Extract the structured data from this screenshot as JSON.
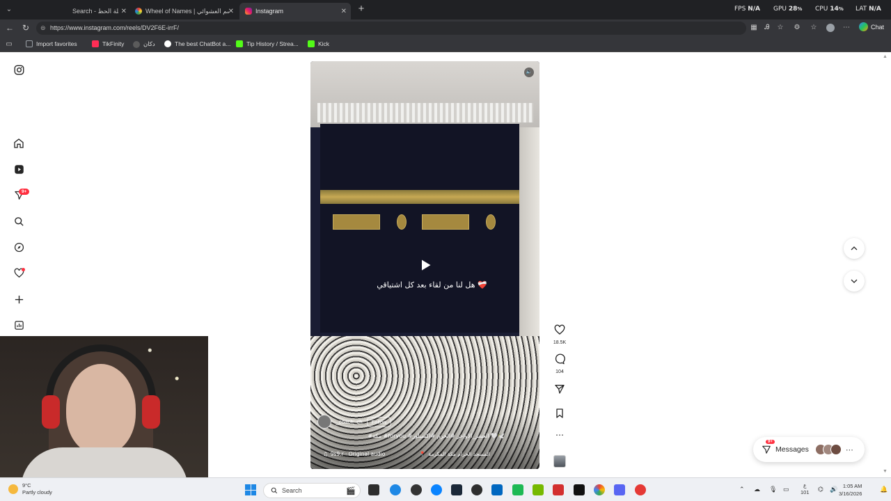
{
  "browser": {
    "tabs": [
      {
        "label": "Search - عجلة الحظ",
        "active": false
      },
      {
        "label": "Wheel of Names | الاسم العشوائي",
        "active": false
      },
      {
        "label": "Instagram",
        "active": true
      }
    ],
    "perf": {
      "fps_label": "FPS",
      "fps_value": "N/A",
      "gpu_label": "GPU",
      "gpu_value": "28",
      "gpu_unit": "%",
      "cpu_label": "CPU",
      "cpu_value": "14",
      "cpu_unit": "%",
      "lat_label": "LAT",
      "lat_value": "N/A"
    },
    "url": "https://www.instagram.com/reels/DV2F6E-irrF/",
    "chat_label": "Chat",
    "bookmarks": [
      {
        "label": "Import favorites",
        "color": "#9aa0a6"
      },
      {
        "label": "TikFinity",
        "color": "#ff2d55"
      },
      {
        "label": "دكان",
        "color": "#5b5b5b"
      },
      {
        "label": "The best ChatBot a...",
        "color": "#ffffff"
      },
      {
        "label": "Tip History / Strea...",
        "color": "#53fc18"
      },
      {
        "label": "Kick",
        "color": "#53fc18"
      }
    ]
  },
  "reel": {
    "caption": "هل لنا من لقاء بعد كل اشتياقي ❤️‍🩹",
    "author": "_coach_ch",
    "follow_label": "Follow",
    "description": "#مكة #foryou #العشر_الاواخر #الحرم #اكسبلور 🤍🕊️",
    "audio": "9s9.r · Original audio",
    "location": "المسجد الحرام مكة المكرمة",
    "likes": "18.5K",
    "comments": "104"
  },
  "sidebar": {
    "notifications_badge": "9+"
  },
  "messages": {
    "label": "Messages",
    "badge": "9+"
  },
  "taskbar": {
    "temp": "9°C",
    "weather": "Partly cloudy",
    "search_label": "Search",
    "lang": "ع",
    "lang_sub": "101",
    "time": "1:05 AM",
    "date": "3/16/2026"
  },
  "colors": {
    "accent_red": "#ff3040",
    "browser_dark": "#35363a"
  }
}
